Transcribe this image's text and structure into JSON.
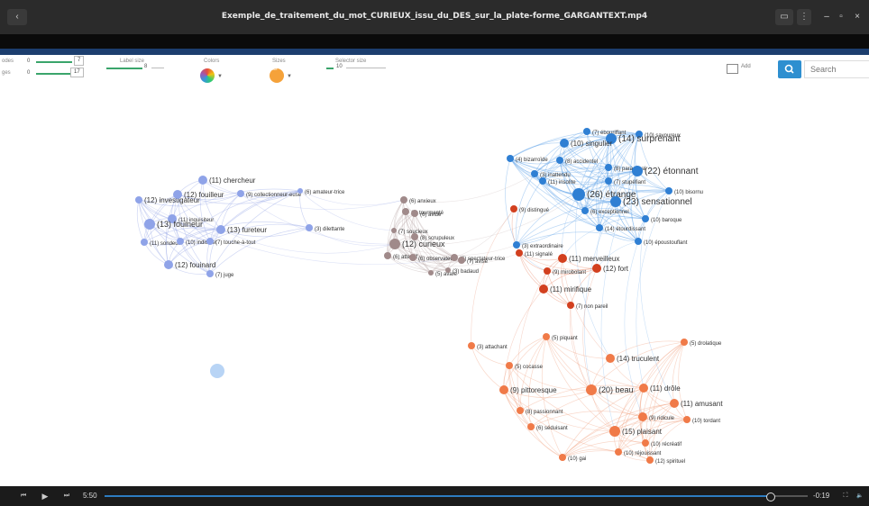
{
  "window": {
    "title": "Exemple_de_traitement_du_mot_CURIEUX_issu_du_DES_sur_la_plate-forme_GARGANTEXT.mp4",
    "back_icon": "‹",
    "cast_icon": "▭",
    "more_icon": "⋮",
    "min_icon": "–",
    "max_icon": "▫",
    "close_icon": "×"
  },
  "controls": {
    "nodes_label": "odes",
    "nodes_min": "0",
    "nodes_max": "7",
    "edges_label": "ges",
    "edges_min": "0",
    "edges_max": "17",
    "label_size_label": "Label size",
    "label_size_value": "8",
    "colors_label": "Colors",
    "sizes_label": "Sizes",
    "sizes_swatch_text": "hide",
    "selector_size_label": "Selector size",
    "selector_size_value": "10",
    "add_label": "Add",
    "search_placeholder": "Search",
    "accent_color": "#2e8fd0"
  },
  "graph": {
    "clusters": [
      {
        "name": "purple",
        "color": "#8fa3e8",
        "edge_color": "#9aa9e6",
        "nodes": [
          {
            "label": "(11) chercheur"
          },
          {
            "label": "(12) investigateur"
          },
          {
            "label": "(12) fouilleur"
          },
          {
            "label": "(9) collectionneur-euse"
          },
          {
            "label": "(6) amateur-trice"
          },
          {
            "label": "(11) inquisiteur"
          },
          {
            "label": "(13) fouineur"
          },
          {
            "label": "(13) fureteur"
          },
          {
            "label": "(3) dilettante"
          },
          {
            "label": "(11) sondeur"
          },
          {
            "label": "(10) indiscret"
          },
          {
            "label": "(7) touche-à-tout"
          },
          {
            "label": "(12) fouinard"
          },
          {
            "label": "(7) juge"
          },
          {
            "label": ""
          }
        ]
      },
      {
        "name": "grey",
        "color": "#a08a8a",
        "edge_color": "#c2b2b2",
        "nodes": [
          {
            "label": "(6) anxieux"
          },
          {
            "label": "(6) tourmenté"
          },
          {
            "label": "(6) avide"
          },
          {
            "label": "(7) soucieux"
          },
          {
            "label": "(8) scrupuleux"
          },
          {
            "label": "(12) curieux"
          },
          {
            "label": "(6) attentif"
          },
          {
            "label": "(6) observateur"
          },
          {
            "label": "(6) spectateur-trice"
          },
          {
            "label": "(7) avisé"
          },
          {
            "label": "(3) badaud"
          },
          {
            "label": "(5) avare"
          }
        ]
      },
      {
        "name": "blue",
        "color": "#2f7fd3",
        "edge_color": "#66a6e8",
        "nodes": [
          {
            "label": "(7) ébouriffant"
          },
          {
            "label": "(10) savoureux"
          },
          {
            "label": "(14) surprenant"
          },
          {
            "label": "(10) singulier"
          },
          {
            "label": "(4) bizarroïde"
          },
          {
            "label": "(8) accidentel"
          },
          {
            "label": "(8) paradoxal"
          },
          {
            "label": "(22) étonnant"
          },
          {
            "label": "(3) inattendu"
          },
          {
            "label": "(11) insolite"
          },
          {
            "label": "(7) stupéfiant"
          },
          {
            "label": "(10) bisornu"
          },
          {
            "label": "(26) étrange"
          },
          {
            "label": "(23) sensationnel"
          },
          {
            "label": "(10) baroque"
          },
          {
            "label": "(14) étourdissant"
          },
          {
            "label": "(10) époustouflant"
          },
          {
            "label": "(3) extraordinaire"
          },
          {
            "label": "(6) exceptionnel"
          }
        ]
      },
      {
        "name": "red",
        "color": "#d2401f",
        "edge_color": "#e98a6a",
        "nodes": [
          {
            "label": "(9) distingué"
          },
          {
            "label": "(11) signalé"
          },
          {
            "label": "(11) merveilleux"
          },
          {
            "label": "(9) mirobolant"
          },
          {
            "label": "(12) fort"
          },
          {
            "label": "(11) mirifique"
          },
          {
            "label": "(7) non pareil"
          }
        ]
      },
      {
        "name": "orange",
        "color": "#f07a48",
        "edge_color": "#f2a98a",
        "nodes": [
          {
            "label": "(3) attachant"
          },
          {
            "label": "(5) piquant"
          },
          {
            "label": "(5) drolatique"
          },
          {
            "label": "(14) truculent"
          },
          {
            "label": "(5) cocasse"
          },
          {
            "label": "(9) pittoresque"
          },
          {
            "label": "(20) beau"
          },
          {
            "label": "(11) drôle"
          },
          {
            "label": "(11) amusant"
          },
          {
            "label": "(8) passionnant"
          },
          {
            "label": "(9) ridicule"
          },
          {
            "label": "(10) tordant"
          },
          {
            "label": "(6) séduisant"
          },
          {
            "label": "(15) plaisant"
          },
          {
            "label": "(10) récréatif"
          },
          {
            "label": "(10) réjouissant"
          },
          {
            "label": "(12) spirituel"
          },
          {
            "label": "(10) gai"
          }
        ]
      }
    ]
  },
  "player": {
    "prev_icon": "⏮",
    "play_icon": "▶",
    "next_icon": "⏭",
    "position": "5:50",
    "remaining": "-0:19",
    "progress": 0.946,
    "fullscreen_icon": "⛶",
    "volume_icon": "🔈"
  }
}
